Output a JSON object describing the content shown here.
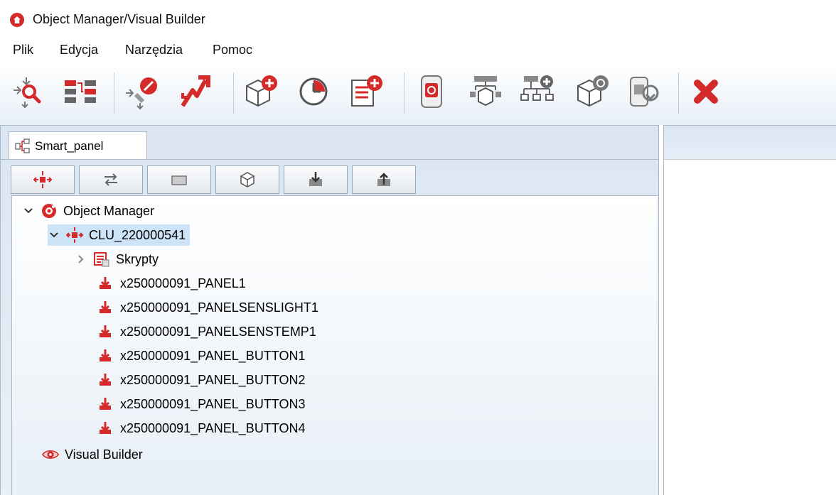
{
  "window": {
    "title": "Object Manager/Visual Builder"
  },
  "menu": {
    "items": [
      "Plik",
      "Edycja",
      "Narzędzia",
      "Pomoc"
    ]
  },
  "toolbar": {
    "buttons": [
      "search-object-icon",
      "layout-grid-icon",
      "erase-object-icon",
      "move-up-icon",
      "add-object-icon",
      "timer-icon",
      "add-document-icon",
      "device-icon",
      "hierarchy-icon",
      "add-hierarchy-icon",
      "refresh-object-icon",
      "device-rotate-icon",
      "close-icon"
    ]
  },
  "left_panel": {
    "tab_label": "Smart_panel",
    "subtoolbar": [
      "center-icon",
      "swap-icon",
      "rectangle-icon",
      "cube-icon",
      "download-icon",
      "upload-icon"
    ],
    "tree": {
      "root": {
        "label": "Object Manager",
        "expanded": true
      },
      "clu": {
        "label": "CLU_220000541",
        "expanded": true,
        "selected": true
      },
      "scripts": {
        "label": "Skrypty",
        "expanded": false
      },
      "items": [
        "x250000091_PANEL1",
        "x250000091_PANELSENSLIGHT1",
        "x250000091_PANELSENSTEMP1",
        "x250000091_PANEL_BUTTON1",
        "x250000091_PANEL_BUTTON2",
        "x250000091_PANEL_BUTTON3",
        "x250000091_PANEL_BUTTON4"
      ],
      "visual_builder": {
        "label": "Visual Builder"
      }
    }
  },
  "colors": {
    "accent_red": "#d42a2a",
    "selection": "#cde3f7",
    "panel_bg": "#dbe6f2"
  }
}
